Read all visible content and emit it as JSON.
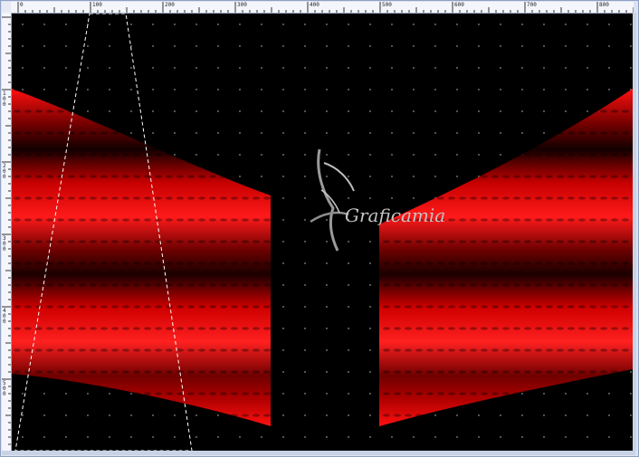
{
  "rulers": {
    "top_labels": [
      "0",
      "100",
      "200",
      "300",
      "400",
      "500",
      "600",
      "700",
      "800"
    ],
    "left_labels": [
      "1\n0\n0",
      "2\n0\n0",
      "3\n0\n0",
      "4\n0\n0",
      "5\n0\n0"
    ]
  },
  "canvas": {
    "background": "#000000",
    "fabric_color": "#ff0000",
    "selection_border": "dashed-white"
  },
  "watermark": {
    "text": "Graficamia"
  },
  "colors": {
    "window_bg": "#dbe3f1",
    "ruler_bg": "#f4f6fb",
    "accent_red": "#ff0000"
  }
}
